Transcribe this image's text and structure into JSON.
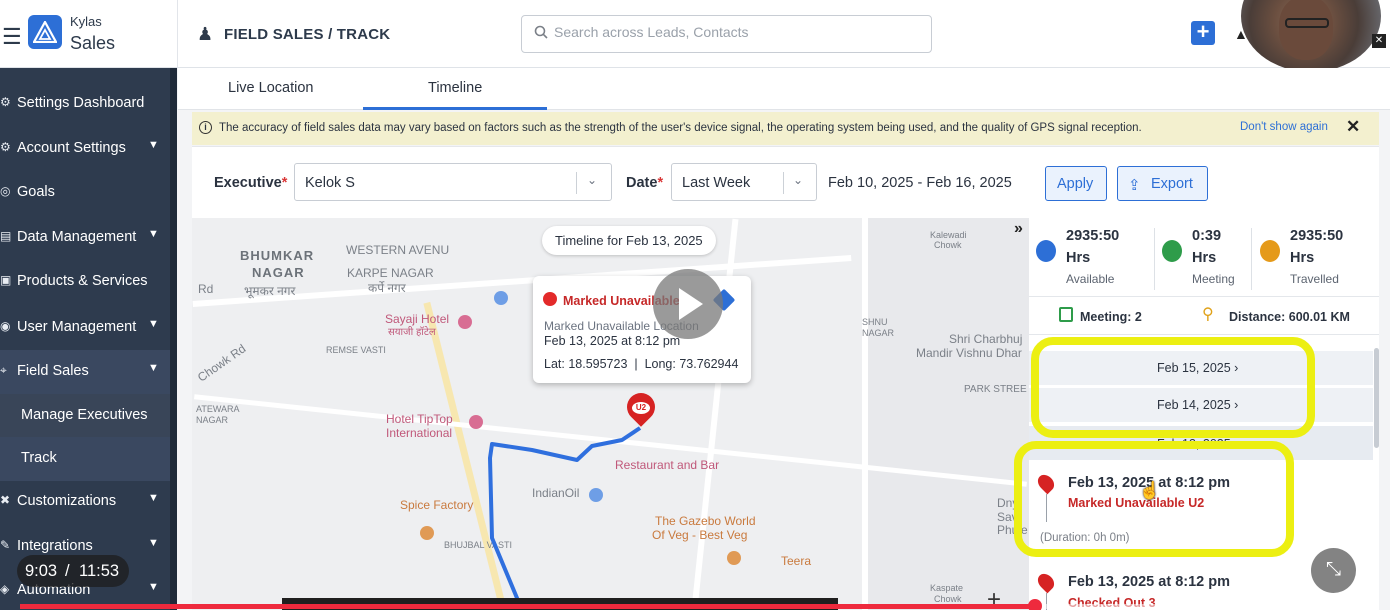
{
  "header": {
    "brand_small": "Kylas",
    "brand_big": "Sales",
    "page_title": "FIELD SALES / TRACK",
    "search_placeholder": "Search across Leads, Contacts"
  },
  "sidebar": {
    "items": [
      {
        "label": "Settings Dashboard",
        "icon": "gear-icon",
        "caret": false
      },
      {
        "label": "Account Settings",
        "icon": "gear-icon",
        "caret": true
      },
      {
        "label": "Goals",
        "icon": "target-icon",
        "caret": false
      },
      {
        "label": "Data Management",
        "icon": "database-icon",
        "caret": true
      },
      {
        "label": "Products & Services",
        "icon": "box-icon",
        "caret": false
      },
      {
        "label": "User Management",
        "icon": "users-icon",
        "caret": true
      },
      {
        "label": "Field Sales",
        "icon": "location-icon",
        "caret": true
      },
      {
        "label": "Manage Executives",
        "icon": "",
        "caret": false
      },
      {
        "label": "Track",
        "icon": "",
        "caret": false
      },
      {
        "label": "Customizations",
        "icon": "tools-icon",
        "caret": true
      },
      {
        "label": "Integrations",
        "icon": "plug-icon",
        "caret": true
      },
      {
        "label": "Automation",
        "icon": "robot-icon",
        "caret": true
      }
    ]
  },
  "tabs": [
    {
      "label": "Live Location"
    },
    {
      "label": "Timeline",
      "active": true
    }
  ],
  "banner": {
    "text": "The accuracy of field sales data may vary based on factors such as the strength of the user's device signal, the operating system being used, and the quality of GPS signal reception.",
    "dismiss": "Don't show again"
  },
  "filters": {
    "executive_label": "Executive",
    "executive_value": "Kelok S",
    "date_label": "Date",
    "date_value": "Last Week",
    "range": "Feb 10, 2025  -  Feb 16, 2025",
    "apply": "Apply",
    "export": "Export"
  },
  "map": {
    "chip": "Timeline for Feb 13, 2025",
    "labels": [
      "BHUMKAR",
      "NAGAR",
      "भूमकर नगर",
      "WESTERN AVENU",
      "KARPE NAGAR",
      "कर्पे नगर",
      "Sayaji Hotel",
      "सयाजी हॉटेल",
      "REMSE VASTI",
      "Hotel TipTop",
      "International",
      "IndianOil",
      "Spice Factory",
      "BHUJBAL VASTI",
      "The Gazebo World",
      "Of Veg - Best Veg",
      "Teera",
      "Rd",
      "Chowk Rd",
      "ATEWARA",
      "NAGAR",
      "Shri Charbhuj",
      "Mandir Vishnu Dhar",
      "PARK STREE",
      "SHNU",
      "NAGAR",
      "Kalewadi",
      "Chowk",
      "Restaurant and Bar",
      "Dny",
      "Sav",
      "Phule",
      "Kaspate",
      "Chowk"
    ],
    "popup": {
      "title": "Marked Unavailable",
      "line1": "Marked Unavailable Location",
      "line2": "Feb 13, 2025 at 8:12 pm",
      "lat": "Lat: 18.595723",
      "long": "Long: 73.762944"
    },
    "marker_label": "U2"
  },
  "stats": [
    {
      "value": "2935:50",
      "unit": "Hrs",
      "name": "Available",
      "color": "#2d6fd6"
    },
    {
      "value": "0:39",
      "unit": "Hrs",
      "name": "Meeting",
      "color": "#2e9c4a"
    },
    {
      "value": "2935:50",
      "unit": "Hrs",
      "name": "Travelled",
      "color": "#e59a1a"
    }
  ],
  "summary": {
    "meeting": "Meeting: 2",
    "distance": "Distance: 600.01 KM"
  },
  "days": [
    {
      "label": "Feb 15, 2025 ›"
    },
    {
      "label": "Feb 14, 2025 ›"
    },
    {
      "label": "Feb 13, 2025 ⌄"
    }
  ],
  "events": [
    {
      "time": "Feb 13, 2025 at 8:12 pm",
      "status": "Marked Unavailable U2",
      "duration": "(Duration: 0h 0m)"
    },
    {
      "time": "Feb 13, 2025 at 8:12 pm",
      "status": "Checked Out 3"
    }
  ],
  "video": {
    "current": "9:03",
    "sep": "/",
    "total": "11:53",
    "progress": 0.76
  }
}
